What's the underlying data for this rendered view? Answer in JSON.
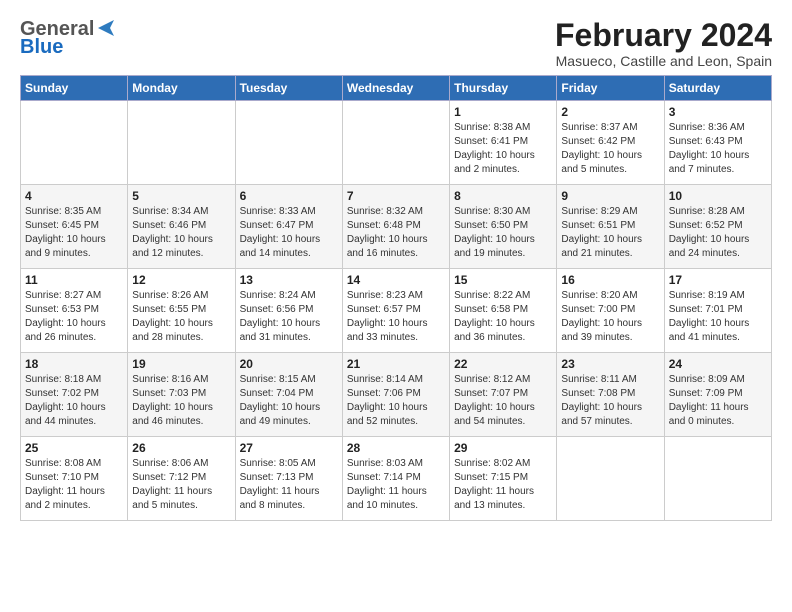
{
  "logo": {
    "general": "General",
    "blue": "Blue"
  },
  "title": "February 2024",
  "subtitle": "Masueco, Castille and Leon, Spain",
  "headers": [
    "Sunday",
    "Monday",
    "Tuesday",
    "Wednesday",
    "Thursday",
    "Friday",
    "Saturday"
  ],
  "weeks": [
    [
      {
        "day": "",
        "info": ""
      },
      {
        "day": "",
        "info": ""
      },
      {
        "day": "",
        "info": ""
      },
      {
        "day": "",
        "info": ""
      },
      {
        "day": "1",
        "info": "Sunrise: 8:38 AM\nSunset: 6:41 PM\nDaylight: 10 hours\nand 2 minutes."
      },
      {
        "day": "2",
        "info": "Sunrise: 8:37 AM\nSunset: 6:42 PM\nDaylight: 10 hours\nand 5 minutes."
      },
      {
        "day": "3",
        "info": "Sunrise: 8:36 AM\nSunset: 6:43 PM\nDaylight: 10 hours\nand 7 minutes."
      }
    ],
    [
      {
        "day": "4",
        "info": "Sunrise: 8:35 AM\nSunset: 6:45 PM\nDaylight: 10 hours\nand 9 minutes."
      },
      {
        "day": "5",
        "info": "Sunrise: 8:34 AM\nSunset: 6:46 PM\nDaylight: 10 hours\nand 12 minutes."
      },
      {
        "day": "6",
        "info": "Sunrise: 8:33 AM\nSunset: 6:47 PM\nDaylight: 10 hours\nand 14 minutes."
      },
      {
        "day": "7",
        "info": "Sunrise: 8:32 AM\nSunset: 6:48 PM\nDaylight: 10 hours\nand 16 minutes."
      },
      {
        "day": "8",
        "info": "Sunrise: 8:30 AM\nSunset: 6:50 PM\nDaylight: 10 hours\nand 19 minutes."
      },
      {
        "day": "9",
        "info": "Sunrise: 8:29 AM\nSunset: 6:51 PM\nDaylight: 10 hours\nand 21 minutes."
      },
      {
        "day": "10",
        "info": "Sunrise: 8:28 AM\nSunset: 6:52 PM\nDaylight: 10 hours\nand 24 minutes."
      }
    ],
    [
      {
        "day": "11",
        "info": "Sunrise: 8:27 AM\nSunset: 6:53 PM\nDaylight: 10 hours\nand 26 minutes."
      },
      {
        "day": "12",
        "info": "Sunrise: 8:26 AM\nSunset: 6:55 PM\nDaylight: 10 hours\nand 28 minutes."
      },
      {
        "day": "13",
        "info": "Sunrise: 8:24 AM\nSunset: 6:56 PM\nDaylight: 10 hours\nand 31 minutes."
      },
      {
        "day": "14",
        "info": "Sunrise: 8:23 AM\nSunset: 6:57 PM\nDaylight: 10 hours\nand 33 minutes."
      },
      {
        "day": "15",
        "info": "Sunrise: 8:22 AM\nSunset: 6:58 PM\nDaylight: 10 hours\nand 36 minutes."
      },
      {
        "day": "16",
        "info": "Sunrise: 8:20 AM\nSunset: 7:00 PM\nDaylight: 10 hours\nand 39 minutes."
      },
      {
        "day": "17",
        "info": "Sunrise: 8:19 AM\nSunset: 7:01 PM\nDaylight: 10 hours\nand 41 minutes."
      }
    ],
    [
      {
        "day": "18",
        "info": "Sunrise: 8:18 AM\nSunset: 7:02 PM\nDaylight: 10 hours\nand 44 minutes."
      },
      {
        "day": "19",
        "info": "Sunrise: 8:16 AM\nSunset: 7:03 PM\nDaylight: 10 hours\nand 46 minutes."
      },
      {
        "day": "20",
        "info": "Sunrise: 8:15 AM\nSunset: 7:04 PM\nDaylight: 10 hours\nand 49 minutes."
      },
      {
        "day": "21",
        "info": "Sunrise: 8:14 AM\nSunset: 7:06 PM\nDaylight: 10 hours\nand 52 minutes."
      },
      {
        "day": "22",
        "info": "Sunrise: 8:12 AM\nSunset: 7:07 PM\nDaylight: 10 hours\nand 54 minutes."
      },
      {
        "day": "23",
        "info": "Sunrise: 8:11 AM\nSunset: 7:08 PM\nDaylight: 10 hours\nand 57 minutes."
      },
      {
        "day": "24",
        "info": "Sunrise: 8:09 AM\nSunset: 7:09 PM\nDaylight: 11 hours\nand 0 minutes."
      }
    ],
    [
      {
        "day": "25",
        "info": "Sunrise: 8:08 AM\nSunset: 7:10 PM\nDaylight: 11 hours\nand 2 minutes."
      },
      {
        "day": "26",
        "info": "Sunrise: 8:06 AM\nSunset: 7:12 PM\nDaylight: 11 hours\nand 5 minutes."
      },
      {
        "day": "27",
        "info": "Sunrise: 8:05 AM\nSunset: 7:13 PM\nDaylight: 11 hours\nand 8 minutes."
      },
      {
        "day": "28",
        "info": "Sunrise: 8:03 AM\nSunset: 7:14 PM\nDaylight: 11 hours\nand 10 minutes."
      },
      {
        "day": "29",
        "info": "Sunrise: 8:02 AM\nSunset: 7:15 PM\nDaylight: 11 hours\nand 13 minutes."
      },
      {
        "day": "",
        "info": ""
      },
      {
        "day": "",
        "info": ""
      }
    ]
  ]
}
